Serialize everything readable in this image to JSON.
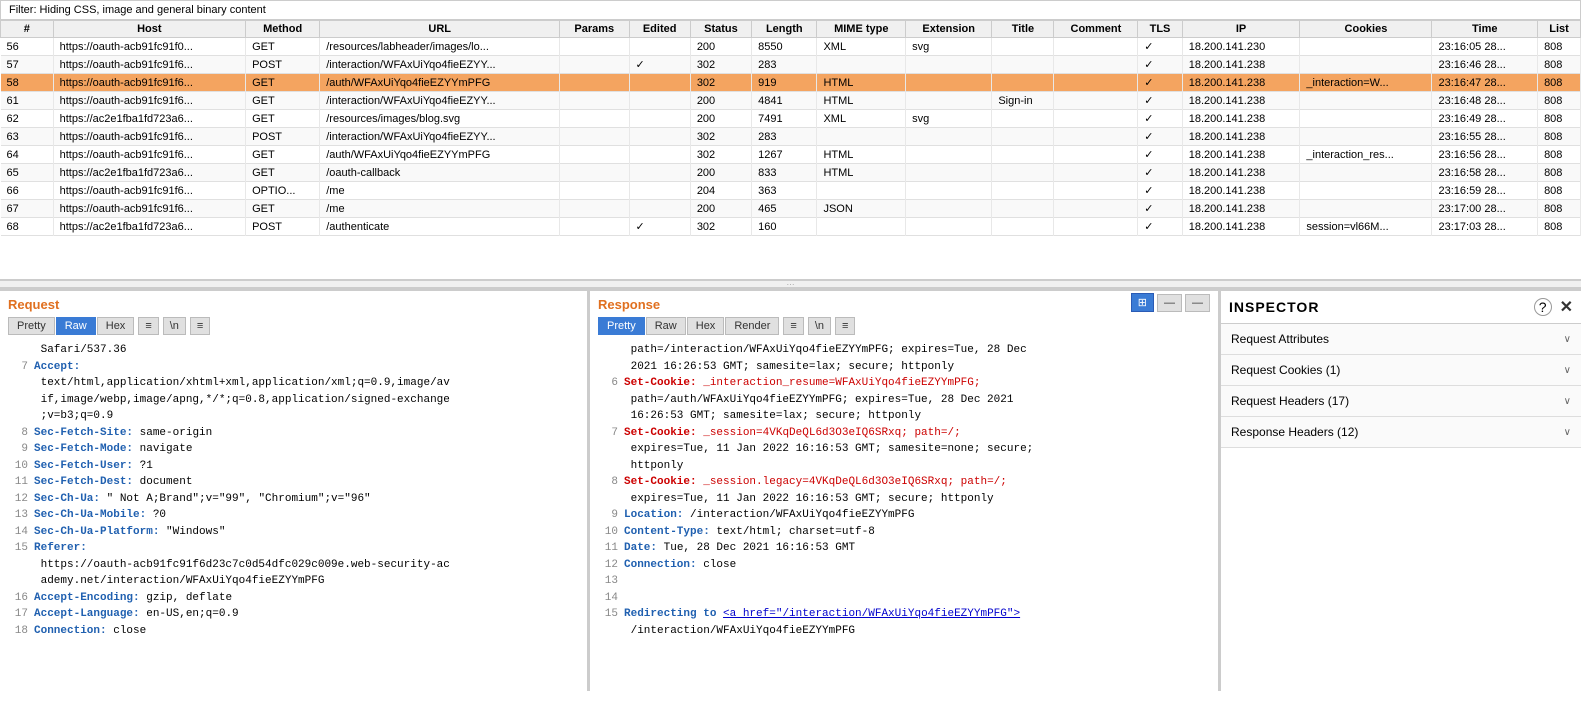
{
  "filter": {
    "text": "Filter: Hiding CSS, image and general binary content"
  },
  "table": {
    "columns": [
      "#",
      "Host",
      "Method",
      "URL",
      "Params",
      "Edited",
      "Status",
      "Length",
      "MIME type",
      "Extension",
      "Title",
      "Comment",
      "TLS",
      "IP",
      "Cookies",
      "Time",
      "List"
    ],
    "rows": [
      {
        "num": "56",
        "host": "https://oauth-acb91fc91f0...",
        "method": "GET",
        "url": "/resources/labheader/images/lo...",
        "params": "",
        "edited": "",
        "status": "200",
        "length": "8550",
        "mime": "XML",
        "ext": "svg",
        "title": "",
        "comment": "",
        "tls": "✓",
        "ip": "18.200.141.230",
        "cookies": "",
        "time": "23:16:05 28...",
        "list": "808",
        "selected": false
      },
      {
        "num": "57",
        "host": "https://oauth-acb91fc91f6...",
        "method": "POST",
        "url": "/interaction/WFAxUiYqo4fieEZYY...",
        "params": "",
        "edited": "✓",
        "status": "302",
        "length": "283",
        "mime": "",
        "ext": "",
        "title": "",
        "comment": "",
        "tls": "✓",
        "ip": "18.200.141.238",
        "cookies": "",
        "time": "23:16:46 28...",
        "list": "808",
        "selected": false
      },
      {
        "num": "58",
        "host": "https://oauth-acb91fc91f6...",
        "method": "GET",
        "url": "/auth/WFAxUiYqo4fieEZYYmPFG",
        "params": "",
        "edited": "",
        "status": "302",
        "length": "919",
        "mime": "HTML",
        "ext": "",
        "title": "",
        "comment": "",
        "tls": "✓",
        "ip": "18.200.141.238",
        "cookies": "_interaction=W...",
        "time": "23:16:47 28...",
        "list": "808",
        "selected": true
      },
      {
        "num": "61",
        "host": "https://oauth-acb91fc91f6...",
        "method": "GET",
        "url": "/interaction/WFAxUiYqo4fieEZYY...",
        "params": "",
        "edited": "",
        "status": "200",
        "length": "4841",
        "mime": "HTML",
        "ext": "",
        "title": "Sign-in",
        "comment": "",
        "tls": "✓",
        "ip": "18.200.141.238",
        "cookies": "",
        "time": "23:16:48 28...",
        "list": "808",
        "selected": false
      },
      {
        "num": "62",
        "host": "https://ac2e1fba1fd723a6...",
        "method": "GET",
        "url": "/resources/images/blog.svg",
        "params": "",
        "edited": "",
        "status": "200",
        "length": "7491",
        "mime": "XML",
        "ext": "svg",
        "title": "",
        "comment": "",
        "tls": "✓",
        "ip": "18.200.141.238",
        "cookies": "",
        "time": "23:16:49 28...",
        "list": "808",
        "selected": false
      },
      {
        "num": "63",
        "host": "https://oauth-acb91fc91f6...",
        "method": "POST",
        "url": "/interaction/WFAxUiYqo4fieEZYY...",
        "params": "",
        "edited": "",
        "status": "302",
        "length": "283",
        "mime": "",
        "ext": "",
        "title": "",
        "comment": "",
        "tls": "✓",
        "ip": "18.200.141.238",
        "cookies": "",
        "time": "23:16:55 28...",
        "list": "808",
        "selected": false
      },
      {
        "num": "64",
        "host": "https://oauth-acb91fc91f6...",
        "method": "GET",
        "url": "/auth/WFAxUiYqo4fieEZYYmPFG",
        "params": "",
        "edited": "",
        "status": "302",
        "length": "1267",
        "mime": "HTML",
        "ext": "",
        "title": "",
        "comment": "",
        "tls": "✓",
        "ip": "18.200.141.238",
        "cookies": "_interaction_res...",
        "time": "23:16:56 28...",
        "list": "808",
        "selected": false
      },
      {
        "num": "65",
        "host": "https://ac2e1fba1fd723a6...",
        "method": "GET",
        "url": "/oauth-callback",
        "params": "",
        "edited": "",
        "status": "200",
        "length": "833",
        "mime": "HTML",
        "ext": "",
        "title": "",
        "comment": "",
        "tls": "✓",
        "ip": "18.200.141.238",
        "cookies": "",
        "time": "23:16:58 28...",
        "list": "808",
        "selected": false
      },
      {
        "num": "66",
        "host": "https://oauth-acb91fc91f6...",
        "method": "OPTIO...",
        "url": "/me",
        "params": "",
        "edited": "",
        "status": "204",
        "length": "363",
        "mime": "",
        "ext": "",
        "title": "",
        "comment": "",
        "tls": "✓",
        "ip": "18.200.141.238",
        "cookies": "",
        "time": "23:16:59 28...",
        "list": "808",
        "selected": false
      },
      {
        "num": "67",
        "host": "https://oauth-acb91fc91f6...",
        "method": "GET",
        "url": "/me",
        "params": "",
        "edited": "",
        "status": "200",
        "length": "465",
        "mime": "JSON",
        "ext": "",
        "title": "",
        "comment": "",
        "tls": "✓",
        "ip": "18.200.141.238",
        "cookies": "",
        "time": "23:17:00 28...",
        "list": "808",
        "selected": false
      },
      {
        "num": "68",
        "host": "https://ac2e1fba1fd723a6...",
        "method": "POST",
        "url": "/authenticate",
        "params": "",
        "edited": "✓",
        "status": "302",
        "length": "160",
        "mime": "",
        "ext": "",
        "title": "",
        "comment": "",
        "tls": "✓",
        "ip": "18.200.141.238",
        "cookies": "session=vl66M...",
        "time": "23:17:03 28...",
        "list": "808",
        "selected": false
      }
    ]
  },
  "request": {
    "title": "Request",
    "tabs": [
      "Pretty",
      "Raw",
      "Hex"
    ],
    "active_tab": "Raw",
    "icons": [
      "≡",
      "\\n",
      "≡"
    ],
    "content_lines": [
      {
        "num": "",
        "text": "Safari/537.36"
      },
      {
        "num": "7",
        "key": "Accept:",
        "val": ""
      },
      {
        "num": "",
        "text": "text/html,application/xhtml+xml,application/xml;q=0.9,image/av"
      },
      {
        "num": "",
        "text": "if,image/webp,image/apng,*/*;q=0.8,application/signed-exchange"
      },
      {
        "num": "",
        "text": ";v=b3;q=0.9"
      },
      {
        "num": "8",
        "key": "Sec-Fetch-Site:",
        "val": " same-origin"
      },
      {
        "num": "9",
        "key": "Sec-Fetch-Mode:",
        "val": " navigate"
      },
      {
        "num": "10",
        "key": "Sec-Fetch-User:",
        "val": " ?1"
      },
      {
        "num": "11",
        "key": "Sec-Fetch-Dest:",
        "val": " document"
      },
      {
        "num": "12",
        "key": "Sec-Ch-Ua:",
        "val": " \" Not A;Brand\";v=\"99\", \"Chromium\";v=\"96\""
      },
      {
        "num": "13",
        "key": "Sec-Ch-Ua-Mobile:",
        "val": " ?0"
      },
      {
        "num": "14",
        "key": "Sec-Ch-Ua-Platform:",
        "val": " \"Windows\""
      },
      {
        "num": "15",
        "key": "Referer:",
        "val": ""
      },
      {
        "num": "",
        "text": "https://oauth-acb91fc91f6d23c7c0d54dfc029c009e.web-security-ac"
      },
      {
        "num": "",
        "text": "ademy.net/interaction/WFAxUiYqo4fieEZYYmPFG"
      },
      {
        "num": "16",
        "key": "Accept-Encoding:",
        "val": " gzip, deflate"
      },
      {
        "num": "17",
        "key": "Accept-Language:",
        "val": " en-US,en;q=0.9"
      },
      {
        "num": "18",
        "key": "Connection:",
        "val": " close"
      }
    ]
  },
  "response": {
    "title": "Response",
    "tabs": [
      "Pretty",
      "Raw",
      "Hex",
      "Render"
    ],
    "active_tab": "Pretty",
    "icons": [
      "≡",
      "\\n",
      "≡"
    ],
    "content_lines": [
      {
        "num": "",
        "text": "path=/interaction/WFAxUiYqo4fieEZYYmPFG; expires=Tue, 28 Dec"
      },
      {
        "num": "",
        "text": "2021 16:26:53 GMT; samesite=lax; secure; httponly"
      },
      {
        "num": "6",
        "key": "Set-Cookie:",
        "val": " _interaction_resume=WFAxUiYqo4fieEZYYmPFG;",
        "red": true
      },
      {
        "num": "",
        "text": "path=/auth/WFAxUiYqo4fieEZYYmPFG; expires=Tue, 28 Dec 2021"
      },
      {
        "num": "",
        "text": "16:26:53 GMT; samesite=lax; secure; httponly"
      },
      {
        "num": "7",
        "key": "Set-Cookie:",
        "val": " _session=4VKqDeQL6d3O3eIQ6SRxq; path=/;",
        "red": true
      },
      {
        "num": "",
        "text": "expires=Tue, 11 Jan 2022 16:16:53 GMT; samesite=none; secure;"
      },
      {
        "num": "",
        "text": "httponly"
      },
      {
        "num": "8",
        "key": "Set-Cookie:",
        "val": " _session.legacy=4VKqDeQL6d3O3eIQ6SRxq; path=/;",
        "red": true
      },
      {
        "num": "",
        "text": "expires=Tue, 11 Jan 2022 16:16:53 GMT; secure; httponly"
      },
      {
        "num": "9",
        "key": "Location:",
        "val": " /interaction/WFAxUiYqo4fieEZYYmPFG"
      },
      {
        "num": "10",
        "key": "Content-Type:",
        "val": " text/html; charset=utf-8"
      },
      {
        "num": "11",
        "key": "Date:",
        "val": " Tue, 28 Dec 2021 16:16:53 GMT"
      },
      {
        "num": "12",
        "key": "Connection:",
        "val": " close"
      },
      {
        "num": "13",
        "text": ""
      },
      {
        "num": "14",
        "text": ""
      },
      {
        "num": "15",
        "key": "Redirecting to ",
        "val": "<a href=\"/interaction/WFAxUiYqo4fieEZYYmPFG\">",
        "link": true
      },
      {
        "num": "",
        "text": "   /interaction/WFAxUiYqo4fieEZYYmPFG"
      }
    ]
  },
  "inspector": {
    "title": "INSPECTOR",
    "sections": [
      {
        "label": "Request Attributes",
        "count": null
      },
      {
        "label": "Request Cookies (1)",
        "count": 1
      },
      {
        "label": "Request Headers (17)",
        "count": 17
      },
      {
        "label": "Response Headers (12)",
        "count": 12
      }
    ]
  },
  "view_buttons": [
    {
      "label": "⊞",
      "active": true
    },
    {
      "label": "—",
      "active": false
    },
    {
      "label": "—",
      "active": false
    }
  ]
}
